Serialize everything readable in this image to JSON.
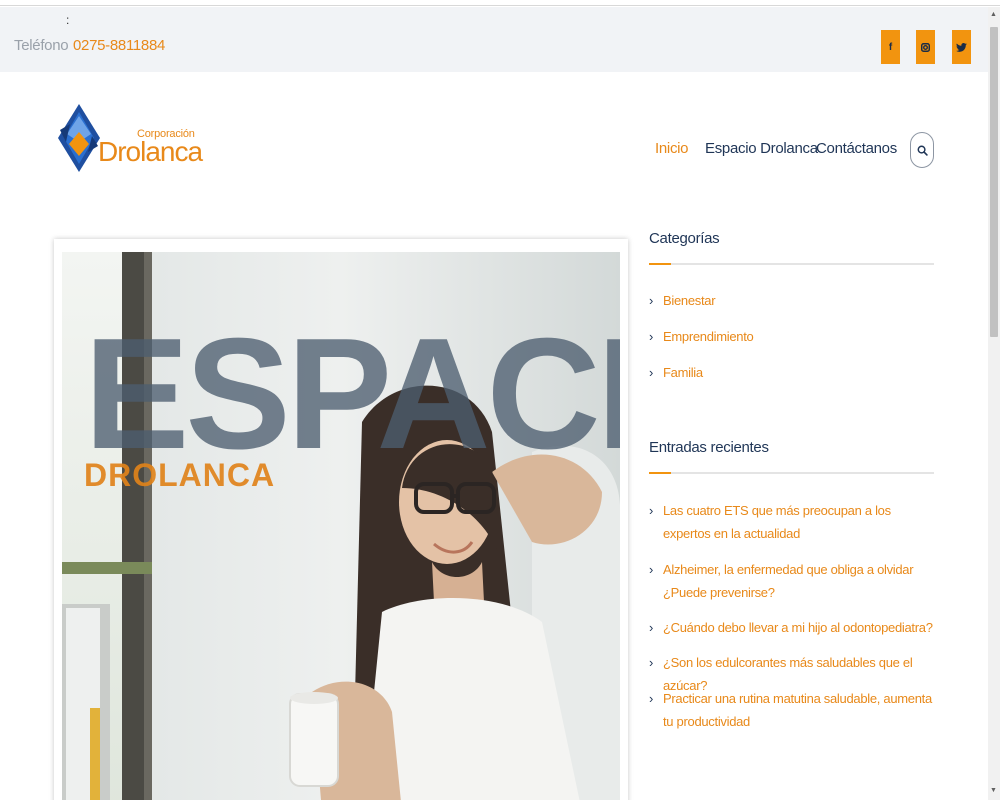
{
  "topbar": {
    "colon": ":",
    "phone_label": "Teléfono",
    "phone_number": "0275-8811884",
    "social": [
      {
        "name": "facebook-icon",
        "glyph": "f"
      },
      {
        "name": "instagram-icon",
        "glyph": "◙"
      },
      {
        "name": "twitter-icon",
        "glyph": "✦"
      }
    ]
  },
  "logo": {
    "small": "Corporación",
    "big": "Drolanca"
  },
  "nav": {
    "items": [
      "Inicio",
      "Espacio Drolanca",
      "Contáctanos"
    ],
    "active": "Inicio",
    "search_icon": "search-icon"
  },
  "hero": {
    "title": "ESPACIO",
    "subtitle": "DROLANCA"
  },
  "sidebar": {
    "categories_title": "Categorías",
    "categories": [
      "Bienestar",
      "Emprendimiento",
      "Familia"
    ],
    "recent_title": "Entradas recientes",
    "recent": [
      "Las cuatro ETS que más preocupan a los expertos en la actualidad",
      "Alzheimer, la enfermedad que obliga a olvidar ¿Puede prevenirse?",
      "¿Cuándo debo llevar a mi hijo al odontopediatra?",
      "¿Son los edulcorantes más saludables que el azúcar?",
      "Practicar una rutina matutina saludable, aumenta tu productividad"
    ]
  },
  "colors": {
    "accent": "#e8891a",
    "social_bg": "#f2940f",
    "navy": "#1f3556",
    "topbar_bg": "#f1f3f6"
  }
}
